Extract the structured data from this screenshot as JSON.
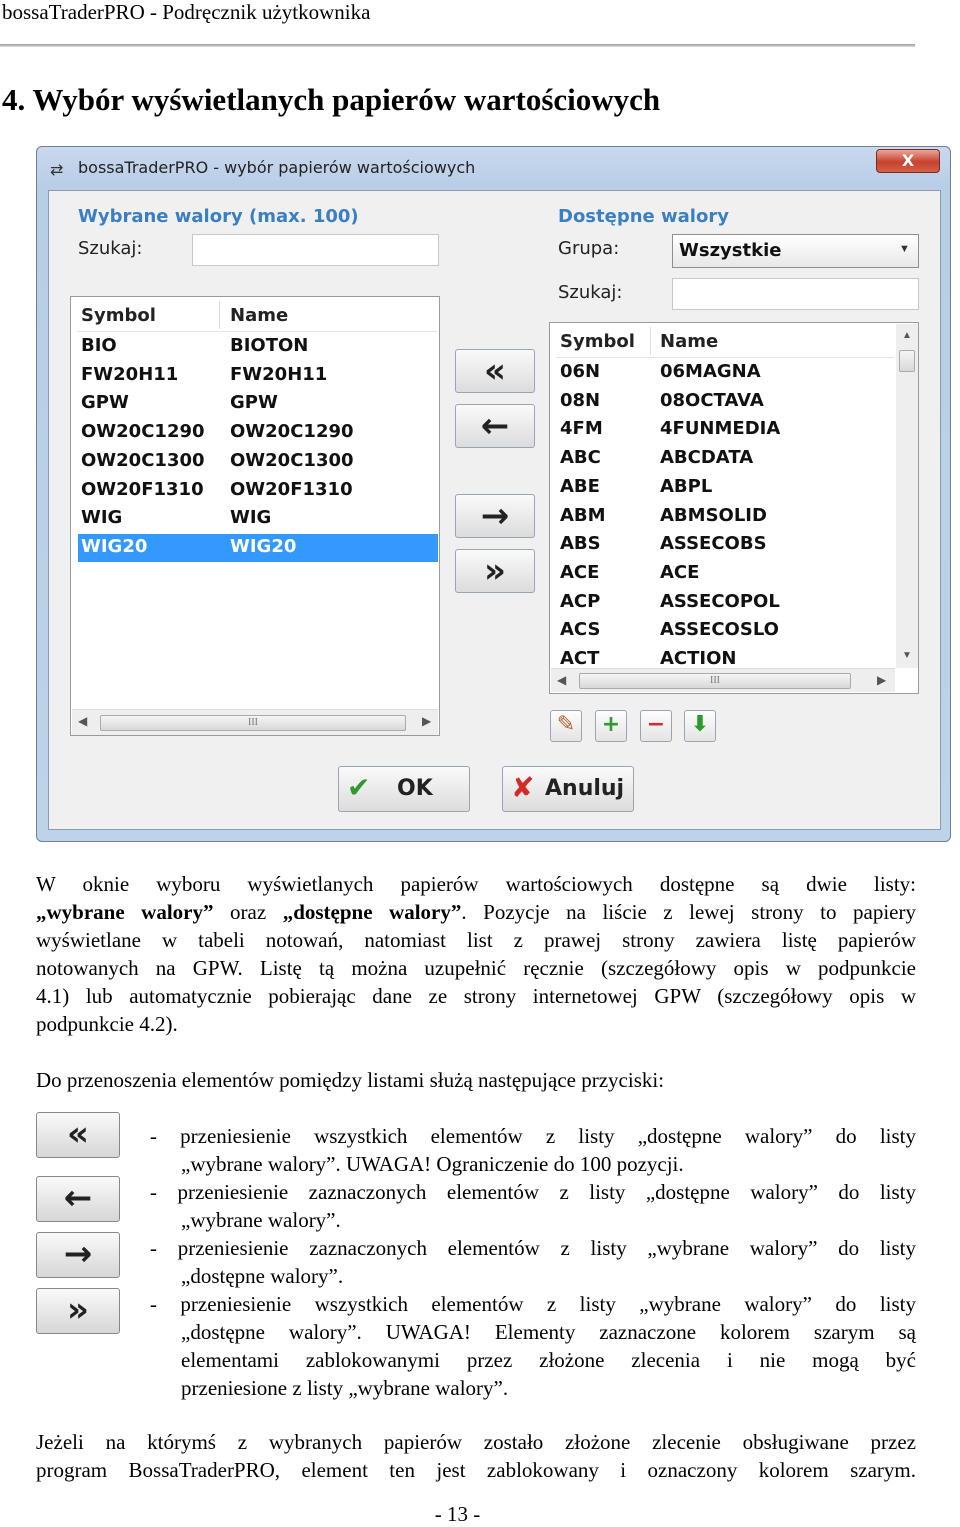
{
  "header": {
    "text": "bossaTraderPRO - Podręcznik użytkownika"
  },
  "heading": "4. Wybór wyświetlanych papierów wartościowych",
  "dialog": {
    "title": "bossaTraderPRO - wybór papierów wartościowych",
    "close_label": "X",
    "left": {
      "section_title": "Wybrane walory (max. 100)",
      "search_label": "Szukaj:",
      "search_value": "",
      "columns": [
        "Symbol",
        "Name"
      ],
      "rows": [
        {
          "symbol": "BIO",
          "name": "BIOTON"
        },
        {
          "symbol": "FW20H11",
          "name": "FW20H11"
        },
        {
          "symbol": "GPW",
          "name": "GPW"
        },
        {
          "symbol": "OW20C1290",
          "name": "OW20C1290"
        },
        {
          "symbol": "OW20C1300",
          "name": "OW20C1300"
        },
        {
          "symbol": "OW20F1310",
          "name": "OW20F1310"
        },
        {
          "symbol": "WIG",
          "name": "WIG"
        },
        {
          "symbol": "WIG20",
          "name": "WIG20"
        }
      ],
      "selected_row": "WIG20",
      "scroll_grip": "III"
    },
    "transfer_buttons": [
      "«",
      "←",
      "→",
      "»"
    ],
    "right": {
      "section_title": "Dostępne walory",
      "group_label": "Grupa:",
      "group_value": "Wszystkie",
      "search_label": "Szukaj:",
      "search_value": "",
      "columns": [
        "Symbol",
        "Name"
      ],
      "rows": [
        {
          "symbol": "06N",
          "name": "06MAGNA"
        },
        {
          "symbol": "08N",
          "name": "08OCTAVA"
        },
        {
          "symbol": "4FM",
          "name": "4FUNMEDIA"
        },
        {
          "symbol": "ABC",
          "name": "ABCDATA"
        },
        {
          "symbol": "ABE",
          "name": "ABPL"
        },
        {
          "symbol": "ABM",
          "name": "ABMSOLID"
        },
        {
          "symbol": "ABS",
          "name": "ASSECOBS"
        },
        {
          "symbol": "ACE",
          "name": "ACE"
        },
        {
          "symbol": "ACP",
          "name": "ASSECOPOL"
        },
        {
          "symbol": "ACS",
          "name": "ASSECOSLO"
        },
        {
          "symbol": "ACT",
          "name": "ACTION"
        }
      ],
      "scroll_grip": "III"
    },
    "tools": [
      {
        "icon": "pencil-icon",
        "glyph": "✎",
        "color": "#b0602a"
      },
      {
        "icon": "plus-icon",
        "glyph": "+",
        "color": "#2e9a2e"
      },
      {
        "icon": "minus-icon",
        "glyph": "−",
        "color": "#d42a2a"
      },
      {
        "icon": "download-icon",
        "glyph": "⬇",
        "color": "#2e9a2e"
      }
    ],
    "ok_label": "OK",
    "cancel_label": "Anuluj"
  },
  "body": {
    "para1": {
      "line1": "W oknie wyboru wyświetlanych papierów wartościowych dostępne są dwie listy:",
      "b1": "„wybrane walory”",
      "t1": " oraz ",
      "b2": "„dostępne walory”",
      "t2": ". Pozycje na liście z lewej strony to papiery",
      "line3": "wyświetlane w tabeli notowań, natomiast list z prawej strony zawiera listę papierów",
      "line4": "notowanych na GPW. Listę tą można uzupełnić ręcznie (szczegółowy opis w podpunkcie",
      "line5": "4.1) lub automatycznie pobierając dane ze strony internetowej GPW (szczegółowy opis w",
      "line6": "podpunkcie 4.2)."
    },
    "para2": "Do przenoszenia elementów pomiędzy listami służą następujące przyciski:",
    "items": [
      {
        "glyph": "«",
        "l1": "- przeniesienie wszystkich elementów z listy „dostępne walory” do listy",
        "rest": [
          "„wybrane walory”. UWAGA! Ograniczenie do 100 pozycji."
        ]
      },
      {
        "glyph": "←",
        "l1": "- przeniesienie zaznaczonych elementów z listy „dostępne walory” do listy",
        "rest": [
          "„wybrane walory”."
        ]
      },
      {
        "glyph": "→",
        "l1": "- przeniesienie zaznaczonych elementów z listy „wybrane walory” do listy",
        "rest": [
          "„dostępne walory”."
        ]
      },
      {
        "glyph": "»",
        "l1": "- przeniesienie wszystkich elementów z listy „wybrane walory” do listy",
        "rest": [
          "„dostępne walory”. UWAGA! Elementy zaznaczone kolorem szarym są",
          "elementami zablokowanymi przez złożone zlecenia i nie mogą być",
          "przeniesione z listy „wybrane walory”."
        ]
      }
    ],
    "para3": {
      "line1": "Jeżeli na którymś z wybranych papierów zostało złożone zlecenie obsługiwane przez",
      "line2": "program BossaTraderPRO, element ten jest zablokowany i oznaczony kolorem szarym."
    }
  },
  "footer": {
    "page": "- 13 -"
  }
}
